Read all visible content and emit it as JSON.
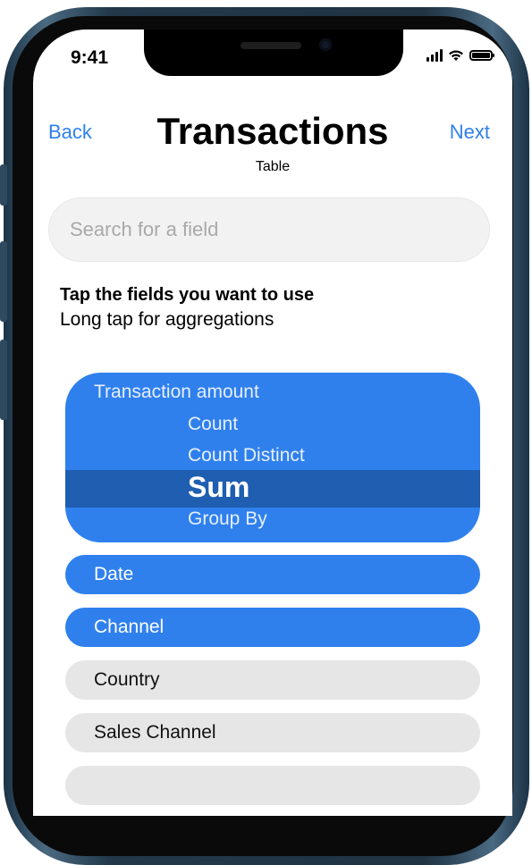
{
  "status_bar": {
    "time": "9:41"
  },
  "nav": {
    "back_label": "Back",
    "next_label": "Next",
    "title": "Transactions",
    "subtitle": "Table"
  },
  "search": {
    "placeholder": "Search for a field"
  },
  "instructions": {
    "title": "Tap the fields you want to use",
    "subtitle": "Long tap for aggregations"
  },
  "aggregation": {
    "field": "Transaction amount",
    "options": [
      "Count",
      "Count Distinct",
      "Sum",
      "Group By"
    ],
    "selected": "Sum"
  },
  "fields": [
    {
      "label": "Date",
      "selected": true
    },
    {
      "label": "Channel",
      "selected": true
    },
    {
      "label": "Country",
      "selected": false
    },
    {
      "label": "Sales Channel",
      "selected": false
    }
  ],
  "colors": {
    "accent": "#2f80ed",
    "accent_dark": "#1f5eb0",
    "pill_off": "#e6e6e6",
    "search_bg": "#f2f2f2"
  }
}
